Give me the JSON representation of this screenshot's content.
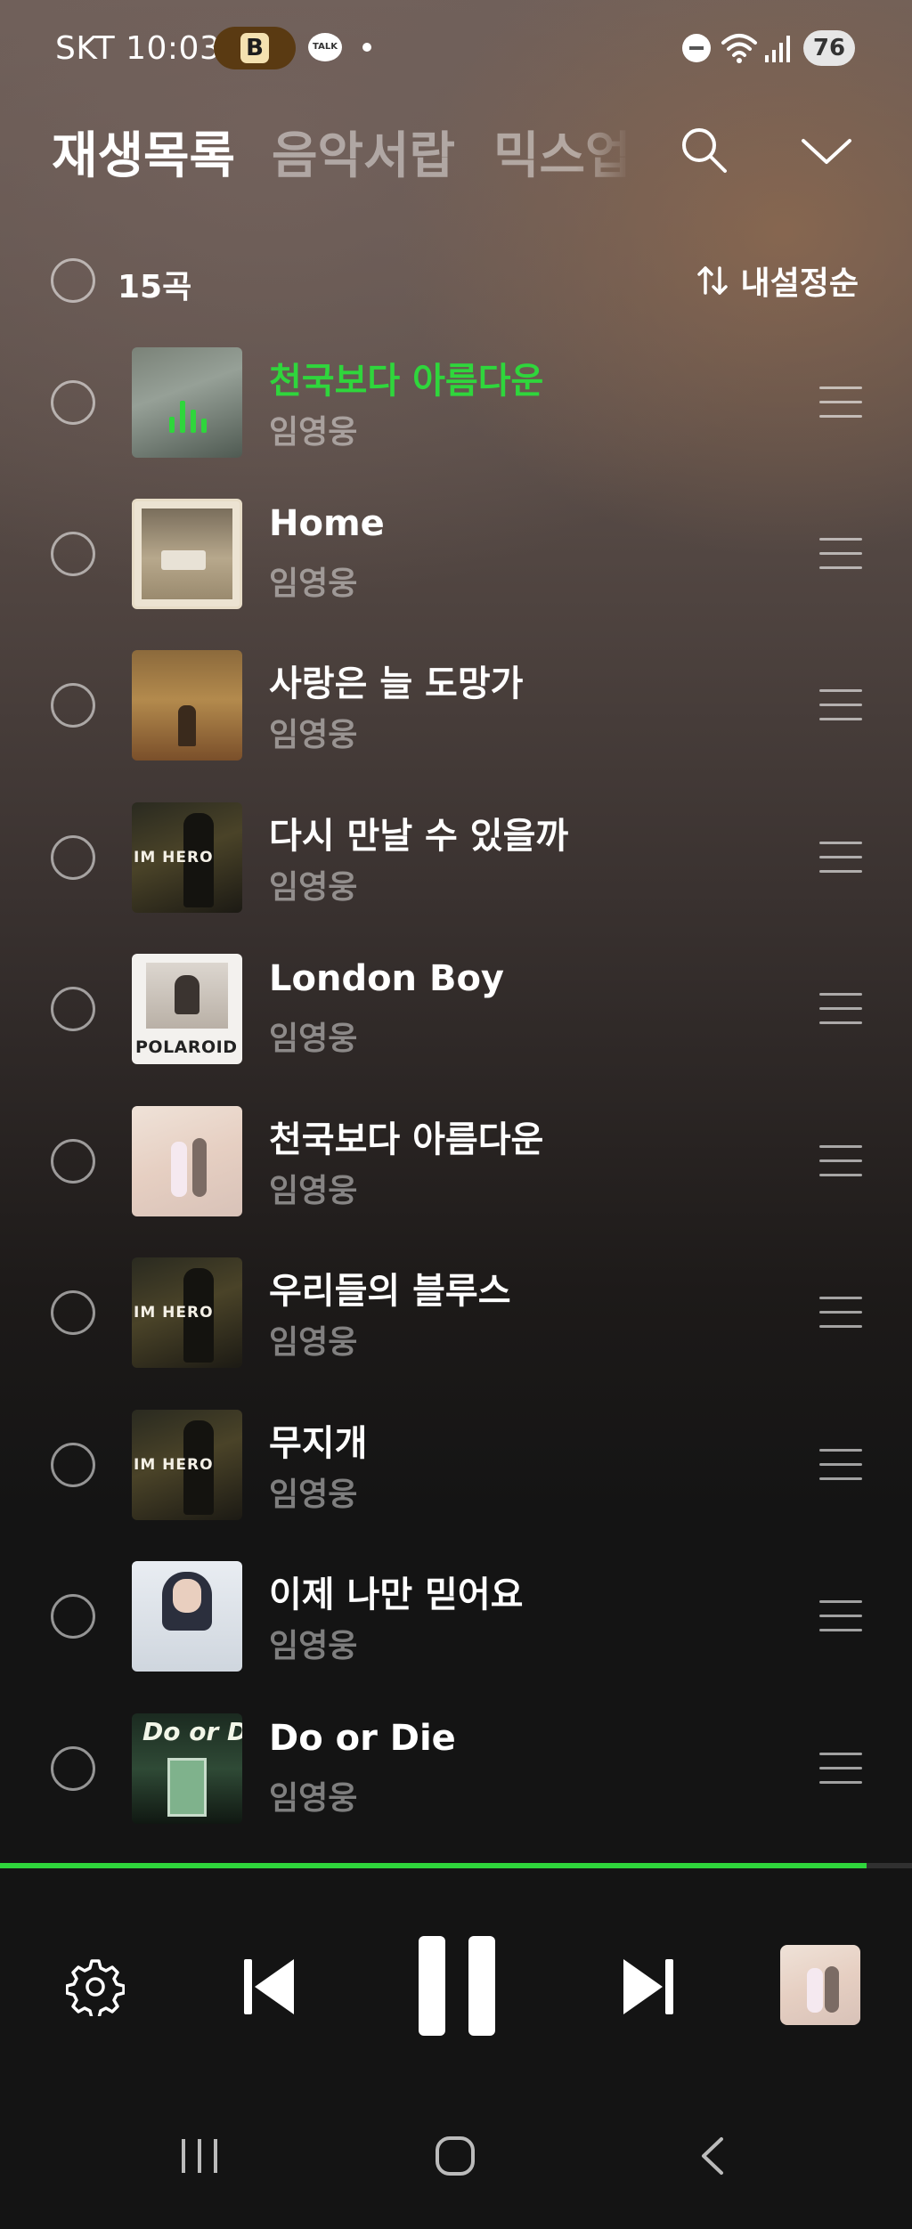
{
  "status_bar": {
    "carrier_time": "SKT 10:03",
    "app_badge": "B",
    "talk_icon_text": "TALK",
    "battery": "76"
  },
  "tabs": [
    "재생목록",
    "음악서랍",
    "믹스업"
  ],
  "list_header": {
    "count": "15곡",
    "sort_label": "내설정순"
  },
  "songs": [
    {
      "title": "천국보다 아름다운",
      "artist": "임영웅",
      "playing": true
    },
    {
      "title": "Home",
      "artist": "임영웅"
    },
    {
      "title": "사랑은 늘 도망가",
      "artist": "임영웅"
    },
    {
      "title": "다시 만날 수 있을까",
      "artist": "임영웅"
    },
    {
      "title": "London Boy",
      "artist": "임영웅"
    },
    {
      "title": "천국보다 아름다운",
      "artist": "임영웅"
    },
    {
      "title": "우리들의 블루스",
      "artist": "임영웅"
    },
    {
      "title": "무지개",
      "artist": "임영웅"
    },
    {
      "title": "이제 나만 믿어요",
      "artist": "임영웅"
    },
    {
      "title": "Do or Die",
      "artist": "임영웅"
    }
  ],
  "album_text": {
    "im_hero": "IM HERO",
    "polaroid": "POLAROID",
    "do_or_die": "Do or Die"
  },
  "player": {
    "progress": 0.95
  },
  "colors": {
    "accent": "#2fd63c",
    "background": "#141414"
  },
  "icons": [
    "search-icon",
    "chevron-down-icon",
    "sort-icon",
    "drag-handle-icon",
    "settings-icon",
    "previous-icon",
    "pause-icon",
    "next-icon",
    "recent-apps-icon",
    "home-icon",
    "back-icon"
  ]
}
